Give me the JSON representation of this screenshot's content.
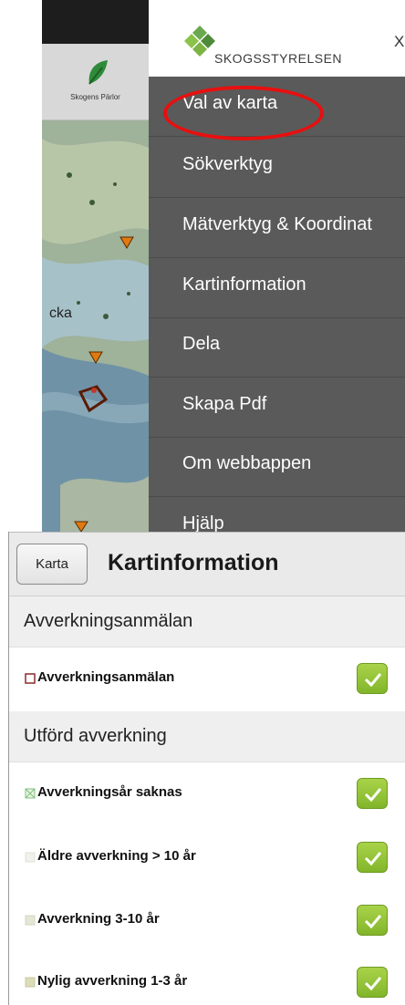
{
  "map": {
    "logo_text": "Skogens Pärlor",
    "partial_label": "cka"
  },
  "drawer": {
    "brand_name": "SKOGSSTYRELSEN",
    "close_label": "X",
    "menu": [
      {
        "label": "Val av karta",
        "highlighted": true
      },
      {
        "label": "Sökverktyg"
      },
      {
        "label": "Mätverktyg & Koordinat"
      },
      {
        "label": "Kartinformation"
      },
      {
        "label": "Dela"
      },
      {
        "label": "Skapa Pdf"
      },
      {
        "label": "Om webbappen"
      },
      {
        "label": "Hjälp"
      }
    ]
  },
  "panel": {
    "back_label": "Karta",
    "title": "Kartinformation",
    "sections": [
      {
        "header": "Avverkningsanmälan",
        "layers": [
          {
            "label": "Avverkningsanmälan",
            "checked": true,
            "legend": "square-outline",
            "color": "#8b2a2a"
          }
        ]
      },
      {
        "header": "Utförd avverkning",
        "layers": [
          {
            "label": "Avverkningsår saknas",
            "checked": true,
            "legend": "square-cross",
            "color": "#8fcf8f"
          },
          {
            "label": "Äldre avverkning > 10 år",
            "checked": true,
            "legend": "square-fill",
            "color": "#f1f1ec"
          },
          {
            "label": "Avverkning 3-10 år",
            "checked": true,
            "legend": "square-fill",
            "color": "#e6e6d6"
          },
          {
            "label": "Nylig avverkning 1-3 år",
            "checked": true,
            "legend": "square-fill",
            "color": "#dcdcb8"
          }
        ]
      }
    ]
  },
  "colors": {
    "drawer_bg": "#5a5a5a",
    "highlight": "#e80f0f",
    "checkbox": "#8dc03a",
    "brand_green": "#6aa84f"
  }
}
